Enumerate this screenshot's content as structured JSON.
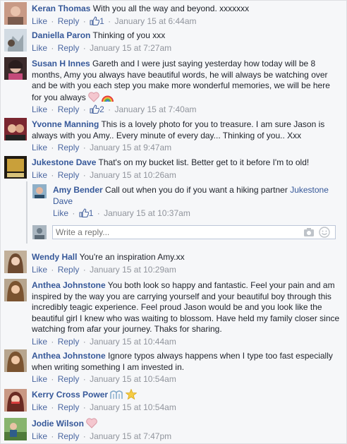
{
  "like_label": "Like",
  "reply_label": "Reply",
  "separator": "·",
  "comments": [
    {
      "name": "Keran Thomas",
      "text": "With you all the way and beyond. xxxxxxx",
      "likes": "1",
      "date": "January 15 at 6:44am"
    },
    {
      "name": "Daniella Paron",
      "text": "Thinking of you xxx",
      "likes": "",
      "date": "January 15 at 7:27am"
    },
    {
      "name": "Susan H Innes",
      "text": "Gareth and I were just saying yesterday how today will be 8 months, Amy you always have beautiful words, he will always be watching over and be with you each step you make more wonderful memories, we will be here for you always",
      "likes": "2",
      "date": "January 15 at 7:40am",
      "emojis": [
        "heart-icon",
        "rainbow-icon"
      ]
    },
    {
      "name": "Yvonne Manning",
      "text": "This is a lovely photo for you to treasure. I am sure Jason is always with you Amy.. Every minute of every day... Thinking of you.. Xxx",
      "likes": "",
      "date": "January 15 at 9:47am"
    },
    {
      "name": "Jukestone Dave",
      "text": "That's on my bucket list. Better get to it before I'm to old!",
      "likes": "",
      "date": "January 15 at 10:26am"
    },
    {
      "name": "Wendy Hall",
      "text": "You're an inspiration Amy.xx",
      "likes": "",
      "date": "January 15 at 10:29am"
    },
    {
      "name": "Anthea Johnstone",
      "text": "You both look so happy and fantastic. Feel your pain and am inspired by the way you are carrying yourself and your beautiful boy through this incredibly teagic experience. Feel proud Jason would be and you look like the beautiful girl I knew who was waiting to blossom. Have held my family closer since watching from afar your journey. Thaks for sharing.",
      "likes": "",
      "date": "January 15 at 10:44am"
    },
    {
      "name": "Anthea Johnstone",
      "text": "Ignore typos always happens when I type too fast especially when writing something I am invested in.",
      "likes": "",
      "date": "January 15 at 10:54am"
    },
    {
      "name": "Kerry Cross Power",
      "text": "",
      "likes": "",
      "date": "January 15 at 10:54am",
      "emojis": [
        "tree-icon",
        "star-icon"
      ]
    },
    {
      "name": "Jodie Wilson",
      "text": "",
      "likes": "",
      "date": "January 15 at 7:47pm",
      "emojis": [
        "heart-icon"
      ]
    }
  ],
  "reply": {
    "name": "Amy Bender",
    "text": "Call out when you do if you want a hiking partner",
    "tag": "Jukestone Dave",
    "likes": "1",
    "date": "January 15 at 10:37am"
  },
  "reply_input": {
    "placeholder": "Write a reply..."
  },
  "colors": {
    "link": "#365899",
    "meta": "#90949c",
    "bg": "#f6f7f9"
  }
}
